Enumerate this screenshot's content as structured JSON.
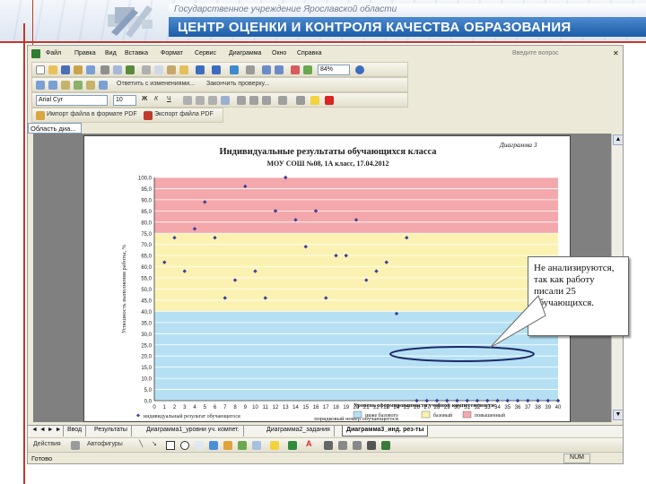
{
  "banner": {
    "subtitle": "Государственное учреждение Ярославской области",
    "title": "ЦЕНТР ОЦЕНКИ И КОНТРОЛЯ КАЧЕСТВА ОБРАЗОВАНИЯ"
  },
  "menu": {
    "items": [
      "Файл",
      "Правка",
      "Вид",
      "Вставка",
      "Формат",
      "Сервис",
      "Диаграмма",
      "Окно",
      "Справка"
    ],
    "ask_placeholder": "Введите вопрос"
  },
  "toolbar": {
    "zoom": "84%",
    "reply_label": "Ответить с изменениями...",
    "end_review_label": "Закончить проверку...",
    "font_name": "Arial Cyr",
    "font_size": "10",
    "import_pdf": "Импорт файла в формате PDF",
    "export_pdf": "Экспорт файла PDF"
  },
  "namebox": "Область диа...",
  "sheet_tabs": [
    "Ввод",
    "Результаты",
    "Диаграмма1_уровни уч. компет.",
    "Диаграмма2_задания",
    "Диаграмма3_инд. рез-ты"
  ],
  "active_tab": "Диаграмма3_инд. рез-ты",
  "drawbar": {
    "actions": "Действия",
    "autoshapes": "Автофигуры"
  },
  "status": {
    "ready": "Готово",
    "num": "NUM"
  },
  "callout_text": "Не анализируются, так как работу писали 25 обучающихся.",
  "colors": {
    "band_high": "#f4a8ab",
    "band_base": "#fbf2b2",
    "band_low": "#b5e0f3",
    "point": "#3a3f9c",
    "banner_blue": "#1d5da8"
  },
  "chart_data": {
    "type": "scatter",
    "diagram_label": "Диаграмма 3",
    "title": "Индивидуальные результаты обучающихся класса",
    "subtitle": "МОУ СОШ №08, 1А класс, 17.04.2012",
    "xlabel": "порядковый номер обучающегося",
    "ylabel": "Успешность выполнения работы, %",
    "xlim": [
      0,
      40
    ],
    "ylim": [
      0,
      100
    ],
    "y_ticks": [
      "0,0",
      "5,0",
      "10,0",
      "15,0",
      "20,0",
      "25,0",
      "30,0",
      "35,0",
      "40,0",
      "45,0",
      "50,0",
      "55,0",
      "60,0",
      "65,0",
      "70,0",
      "75,0",
      "80,0",
      "85,0",
      "90,0",
      "95,0",
      "100,0"
    ],
    "x_ticks": [
      "0",
      "1",
      "2",
      "3",
      "4",
      "5",
      "6",
      "7",
      "8",
      "9",
      "10",
      "11",
      "12",
      "13",
      "14",
      "15",
      "16",
      "17",
      "18",
      "19",
      "20",
      "21",
      "22",
      "23",
      "24",
      "25",
      "26",
      "27",
      "28",
      "29",
      "30",
      "31",
      "32",
      "33",
      "34",
      "35",
      "36",
      "37",
      "38",
      "39",
      "40"
    ],
    "bands": [
      {
        "from": 0,
        "to": 40,
        "label": "ниже базового",
        "color": "#b5e0f3"
      },
      {
        "from": 40,
        "to": 75,
        "label": "базовый",
        "color": "#fbf2b2"
      },
      {
        "from": 75,
        "to": 100,
        "label": "повышенный",
        "color": "#f4a8ab"
      }
    ],
    "series": [
      {
        "name": "индивидуальный результат обучающегося",
        "x": [
          1,
          2,
          3,
          4,
          5,
          6,
          7,
          8,
          9,
          10,
          11,
          12,
          13,
          14,
          15,
          16,
          17,
          18,
          19,
          20,
          21,
          22,
          23,
          24,
          25,
          26,
          27,
          28,
          29,
          30,
          31,
          32,
          33,
          34,
          35,
          36,
          37,
          38,
          39,
          40
        ],
        "y": [
          62,
          73,
          58,
          77,
          89,
          73,
          46,
          54,
          96,
          58,
          46,
          85,
          100,
          81,
          69,
          85,
          46,
          65,
          65,
          81,
          54,
          58,
          62,
          39,
          73,
          0,
          0,
          0,
          0,
          0,
          0,
          0,
          0,
          0,
          0,
          0,
          0,
          0,
          0,
          0
        ]
      }
    ],
    "legend_title": "Уровень сформированности учебной компетентности:",
    "grid": true
  }
}
